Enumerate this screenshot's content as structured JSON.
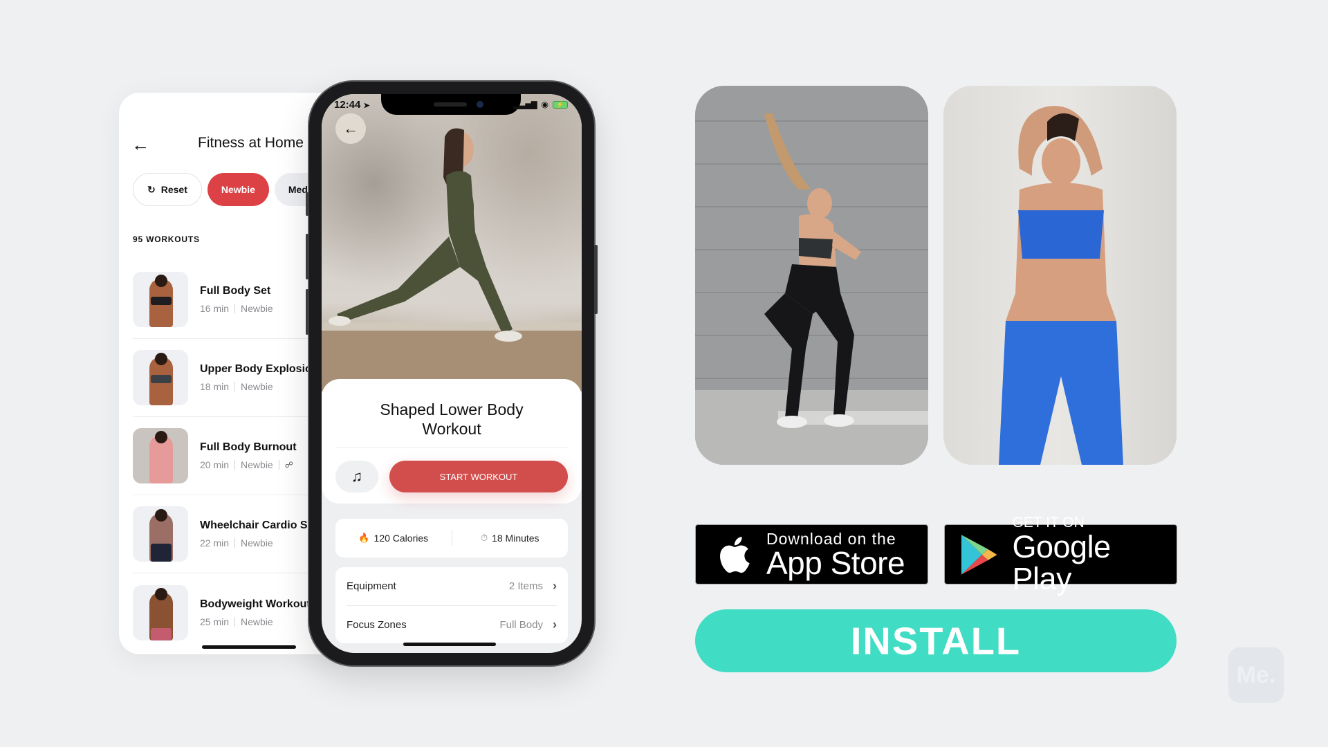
{
  "list_screen": {
    "title": "Fitness at Home",
    "back_icon": "arrow-left-icon",
    "filters": [
      {
        "label": "Reset",
        "icon": "refresh-icon",
        "state": "default"
      },
      {
        "label": "Newbie",
        "state": "active"
      },
      {
        "label": "Medium",
        "state": "default"
      }
    ],
    "section_label": "95 WORKOUTS",
    "workouts": [
      {
        "title": "Full Body Set",
        "duration": "16 min",
        "level": "Newbie"
      },
      {
        "title": "Upper Body Explosion",
        "duration": "18 min",
        "level": "Newbie"
      },
      {
        "title": "Full Body Burnout",
        "duration": "20 min",
        "level": "Newbie",
        "equipment_icon": "dumbbell-icon"
      },
      {
        "title": "Wheelchair Cardio Set",
        "duration": "22 min",
        "level": "Newbie"
      },
      {
        "title": "Bodyweight Workout",
        "duration": "25 min",
        "level": "Newbie"
      }
    ]
  },
  "detail_screen": {
    "status_time": "12:44",
    "status_location_icon": "location-arrow-icon",
    "workout_title": "Shaped Lower Body Workout",
    "music_icon": "music-note-icon",
    "start_button": "START WORKOUT",
    "stats": {
      "calories": "120 Calories",
      "minutes": "18 Minutes"
    },
    "info_rows": [
      {
        "label": "Equipment",
        "value": "2 Items"
      },
      {
        "label": "Focus Zones",
        "value": "Full Body"
      }
    ]
  },
  "store_badges": {
    "apple": {
      "small": "Download on the",
      "big": "App Store"
    },
    "google": {
      "small": "GET IT ON",
      "big": "Google Play"
    }
  },
  "install_button": "INSTALL",
  "watermark": "Me.",
  "colors": {
    "accent_red": "#dc4146",
    "install_teal": "#40dcc3",
    "background": "#eff0f2"
  }
}
